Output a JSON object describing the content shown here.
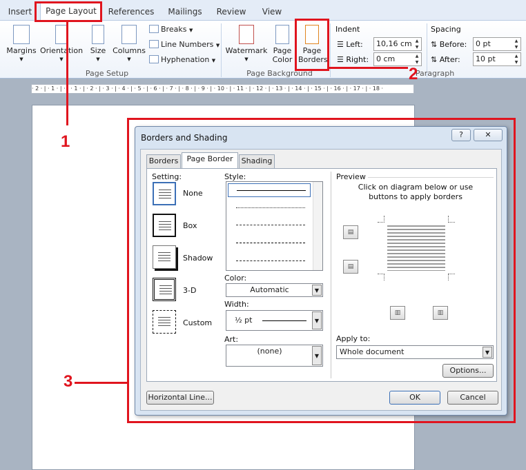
{
  "ribbon": {
    "tabs": [
      "Insert",
      "Page Layout",
      "References",
      "Mailings",
      "Review",
      "View"
    ],
    "active_tab": "Page Layout",
    "page_setup": {
      "margins": "Margins",
      "orientation": "Orientation",
      "size": "Size",
      "columns": "Columns",
      "breaks": "Breaks",
      "line_numbers": "Line Numbers",
      "hyphenation": "Hyphenation",
      "group_label": "Page Setup"
    },
    "page_background": {
      "watermark": "Watermark",
      "page_color_1": "Page",
      "page_color_2": "Color",
      "page_borders_1": "Page",
      "page_borders_2": "Borders",
      "group_label": "Page Background"
    },
    "paragraph": {
      "indent_label": "Indent",
      "left_label": "Left:",
      "left_value": "10,16 cm",
      "right_label": "Right:",
      "right_value": "0 cm",
      "spacing_label": "Spacing",
      "before_label": "Before:",
      "before_value": "0 pt",
      "after_label": "After:",
      "after_value": "10 pt",
      "group_label": "Paragraph"
    }
  },
  "ruler_text": "· 2 · | · 1 · | · · · 1 · | · 2 · | · 3 · | · 4 · | · 5 · | · 6 · | · 7 · | · 8 · | · 9 · | · 10 · | · 11 · | · 12 · | · 13 · | · 14 · | · 15 · | · 16 · | · 17 · | · 18 ·",
  "annotations": [
    "1",
    "2",
    "3"
  ],
  "dialog": {
    "title": "Borders and Shading",
    "help": "?",
    "close": "✕",
    "tabs": [
      "Borders",
      "Page Border",
      "Shading"
    ],
    "active_tab": "Page Border",
    "setting_label": "Setting:",
    "settings": [
      "None",
      "Box",
      "Shadow",
      "3-D",
      "Custom"
    ],
    "style_label": "Style:",
    "color_label": "Color:",
    "color_value": "Automatic",
    "width_label": "Width:",
    "width_value": "½ pt",
    "art_label": "Art:",
    "art_value": "(none)",
    "preview_label": "Preview",
    "preview_hint_1": "Click on diagram below or use",
    "preview_hint_2": "buttons to apply borders",
    "apply_label": "Apply to:",
    "apply_value": "Whole document",
    "options_button": "Options...",
    "horizontal_line_button": "Horizontal Line...",
    "ok_button": "OK",
    "cancel_button": "Cancel"
  },
  "colors": {
    "annotation_red": "#e0141e",
    "ribbon_bg": "#e4ecf7"
  }
}
